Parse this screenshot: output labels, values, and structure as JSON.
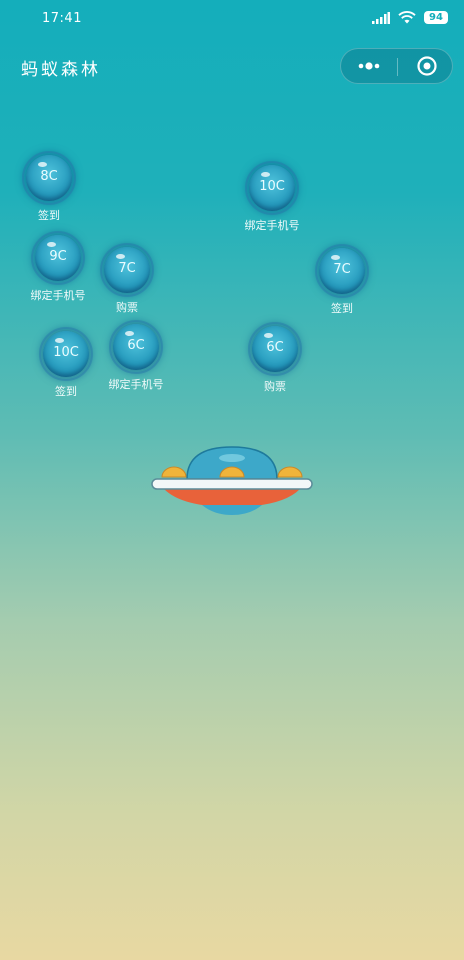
{
  "status_bar": {
    "time": "17:41",
    "battery": "94"
  },
  "nav": {
    "title": "蚂蚁森林"
  },
  "bubbles": [
    {
      "value": "8C",
      "label": "签到"
    },
    {
      "value": "10C",
      "label": "绑定手机号"
    },
    {
      "value": "9C",
      "label": "绑定手机号"
    },
    {
      "value": "7C",
      "label": "购票"
    },
    {
      "value": "7C",
      "label": "签到"
    },
    {
      "value": "10C",
      "label": "签到"
    },
    {
      "value": "6C",
      "label": "绑定手机号"
    },
    {
      "value": "6C",
      "label": "购票"
    }
  ],
  "colors": {
    "background_top": "#14aebb",
    "background_bottom": "#e8d8a2",
    "ufo_body": "#e8623a",
    "ufo_dome": "#3da8c9",
    "ufo_lights": "#f0b43a"
  }
}
